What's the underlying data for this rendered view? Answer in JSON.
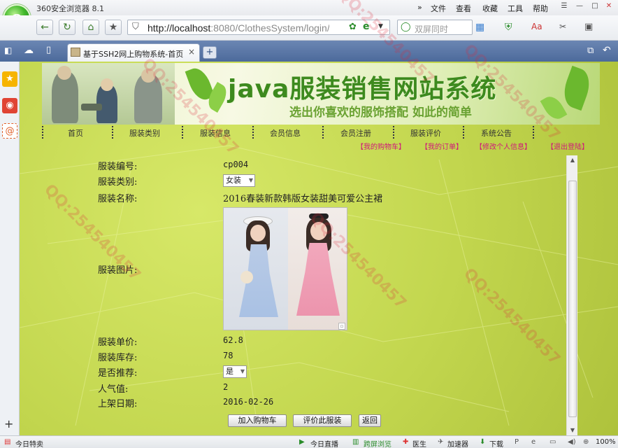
{
  "browser": {
    "app_title": "360安全浏览器 8.1",
    "logo_letter": "e",
    "menu": [
      "文件",
      "查看",
      "收藏",
      "工具",
      "帮助"
    ],
    "url_host": "http://localhost",
    "url_rest": ":8080/ClothesSystem/login/",
    "search_placeholder": "双屏同时",
    "tab_title": "基于SSH2网上购物系统-首页",
    "tab_close": "×",
    "new_tab": "+"
  },
  "site": {
    "banner_title": "java服装销售网站系统",
    "banner_subtitle": "选出你喜欢的服饰搭配 如此的简单",
    "nav": [
      "首页",
      "服装类别",
      "服装信息",
      "会员信息",
      "会员注册",
      "服装评价",
      "系统公告"
    ],
    "user_links": [
      "【我的购物车】",
      "【我的订单】",
      "【修改个人信息】",
      "【退出登陆】"
    ]
  },
  "detail": {
    "labels": {
      "code": "服装编号:",
      "category": "服装类别:",
      "name": "服装名称:",
      "image": "服装图片:",
      "price": "服装单价:",
      "stock": "服装库存:",
      "recommend": "是否推荐:",
      "popularity": "人气值:",
      "date": "上架日期:"
    },
    "values": {
      "code": "cp004",
      "category": "女装",
      "name": "2016春装新款韩版女装甜美可爱公主裙",
      "price": "62.8",
      "stock": "78",
      "recommend": "是",
      "popularity": "2",
      "date": "2016-02-26"
    },
    "buttons": {
      "add_cart": "加入购物车",
      "review": "评价此服装",
      "back": "返回"
    }
  },
  "statusbar": {
    "left": "今日特卖",
    "items": [
      "今日直播",
      "跨屏浏览",
      "医生",
      "加速器",
      "下载"
    ],
    "zoom": "100%"
  },
  "watermark": "QQ:254540457"
}
